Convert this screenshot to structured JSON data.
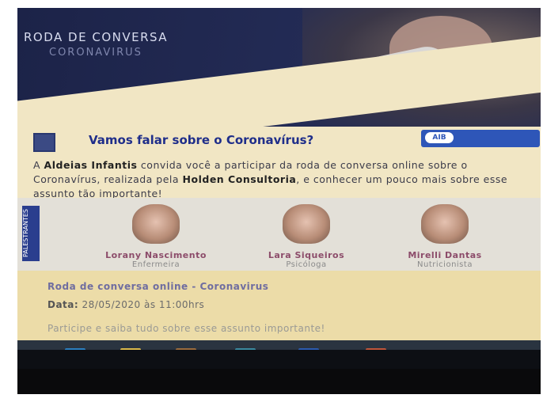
{
  "banner": {
    "title": "RODA DE CONVERSA",
    "subtitle": "CORONAVIRUS"
  },
  "section": {
    "heading": "Vamos falar sobre o Coronavírus?",
    "icon": "chat-icon",
    "logo_text": "AIB"
  },
  "intro": {
    "part1": "A ",
    "org": "Aldeias Infantis",
    "part2": " convida você a participar da roda de conversa online sobre o Coronavírus, realizada pela ",
    "partner": "Holden Consultoria",
    "part3": ", e conhecer um pouco mais sobre esse assunto tão importante!"
  },
  "speakers_tab": "PALESTRANTES",
  "speakers": [
    {
      "name": "Lorany Nascimento",
      "role": "Enfermeira"
    },
    {
      "name": "Lara Siqueiros",
      "role": "Psicóloga"
    },
    {
      "name": "Mirelli Dantas",
      "role": "Nutricionista"
    }
  ],
  "event": {
    "title": "Roda de conversa online - Coronavirus",
    "date_label": "Data:",
    "date_value": "28/05/2020 às 11:00hrs",
    "footer": "Participe e saiba tudo sobre esse assunto importante!"
  },
  "taskbar": {
    "items": [
      "edge-icon",
      "folder-icon",
      "store-icon",
      "mail-icon",
      "word-icon",
      "browser-icon"
    ],
    "colors": [
      "#2a7fc0",
      "#d9b84a",
      "#9a6b3c",
      "#3a8aa0",
      "#2b5bb0",
      "#c0553a"
    ]
  }
}
